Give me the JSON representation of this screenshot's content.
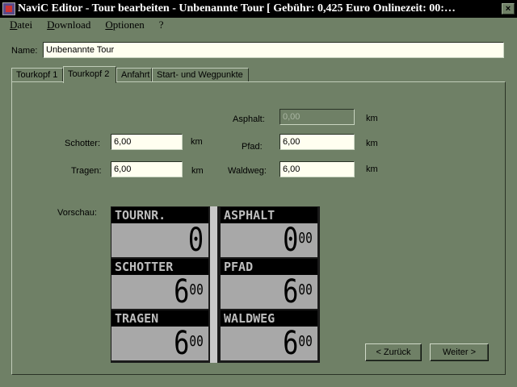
{
  "window": {
    "title": "NaviC Editor - Tour bearbeiten - Unbenannte Tour [ Gebühr: 0,425 Euro Onlinezeit: 00:…",
    "close_label": "×"
  },
  "menu": [
    {
      "label": "Datei"
    },
    {
      "label": "Download"
    },
    {
      "label": "Optionen"
    },
    {
      "label": "?"
    }
  ],
  "name_field": {
    "label": "Name:",
    "value": "Unbenannte Tour"
  },
  "tabs": [
    {
      "label": "Tourkopf 1",
      "active": false
    },
    {
      "label": "Tourkopf 2",
      "active": true
    },
    {
      "label": "Anfahrt",
      "active": false
    },
    {
      "label": "Start- und Wegpunkte",
      "active": false
    }
  ],
  "fields": {
    "schotter": {
      "label": "Schotter:",
      "value": "6,00",
      "unit": "km"
    },
    "tragen": {
      "label": "Tragen:",
      "value": "6,00",
      "unit": "km"
    },
    "asphalt": {
      "label": "Asphalt:",
      "value": "0,00",
      "unit": "km",
      "disabled": true
    },
    "pfad": {
      "label": "Pfad:",
      "value": "6,00",
      "unit": "km"
    },
    "waldweg": {
      "label": "Waldweg:",
      "value": "6,00",
      "unit": "km"
    }
  },
  "preview": {
    "label": "Vorschau:",
    "cells": [
      {
        "head": "TOURNR.",
        "value": "0",
        "sup": ""
      },
      {
        "head": "ASPHALT",
        "value": "0",
        "sup": "00"
      },
      {
        "head": "SCHOTTER",
        "value": "6",
        "sup": "00"
      },
      {
        "head": "PFAD",
        "value": "6",
        "sup": "00"
      },
      {
        "head": "TRAGEN",
        "value": "6",
        "sup": "00"
      },
      {
        "head": "WALDWEG",
        "value": "6",
        "sup": "00"
      }
    ]
  },
  "buttons": {
    "back": "< Zurück",
    "next": "Weiter >"
  }
}
